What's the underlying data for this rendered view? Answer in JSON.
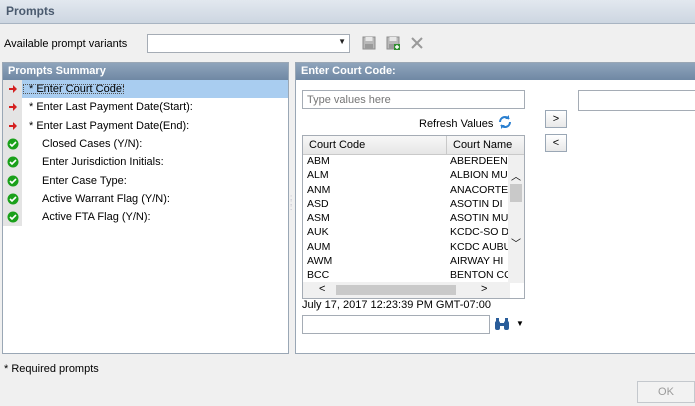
{
  "window": {
    "title": "Prompts"
  },
  "variants": {
    "label": "Available prompt variants",
    "selected": ""
  },
  "toolbar": {
    "save_icon": "save-icon",
    "save_as_icon": "save-as-icon",
    "delete_icon": "delete-icon"
  },
  "summary": {
    "header": "Prompts Summary",
    "items": [
      {
        "label": "* Enter Court Code:",
        "status": "required-arrow",
        "selected": true
      },
      {
        "label": "* Enter Last Payment Date(Start):",
        "status": "required-arrow",
        "selected": false
      },
      {
        "label": "* Enter Last Payment Date(End):",
        "status": "required-arrow",
        "selected": false
      },
      {
        "label": "Closed Cases (Y/N):",
        "status": "check",
        "selected": false
      },
      {
        "label": "Enter Jurisdiction Initials:",
        "status": "check",
        "selected": false
      },
      {
        "label": "Enter Case Type:",
        "status": "check",
        "selected": false
      },
      {
        "label": "Active Warrant Flag (Y/N):",
        "status": "check",
        "selected": false
      },
      {
        "label": "Active FTA Flag (Y/N):",
        "status": "check",
        "selected": false
      }
    ]
  },
  "detail": {
    "header": "Enter Court Code:",
    "type_placeholder": "Type values here",
    "refresh_label": "Refresh Values",
    "columns": [
      "Court Code",
      "Court Name"
    ],
    "rows": [
      [
        "ABM",
        "ABERDEEN"
      ],
      [
        "ALM",
        "ALBION MU"
      ],
      [
        "ANM",
        "ANACORTE"
      ],
      [
        "ASD",
        "ASOTIN DI"
      ],
      [
        "ASM",
        "ASOTIN MU"
      ],
      [
        "AUK",
        "KCDC-SO D"
      ],
      [
        "AUM",
        "KCDC AUBU"
      ],
      [
        "AWM",
        "AIRWAY HI"
      ],
      [
        "BCC",
        "BENTON CO"
      ]
    ],
    "timestamp": "July 17, 2017 12:23:39 PM GMT-07:00",
    "add_label": ">",
    "remove_label": "<"
  },
  "footer": {
    "note": "* Required prompts",
    "ok_label": "OK"
  },
  "colors": {
    "selected_row": "#a9cdf0",
    "header": "#7a91ac",
    "check": "#1aa01a",
    "arrow": "#d42020"
  }
}
